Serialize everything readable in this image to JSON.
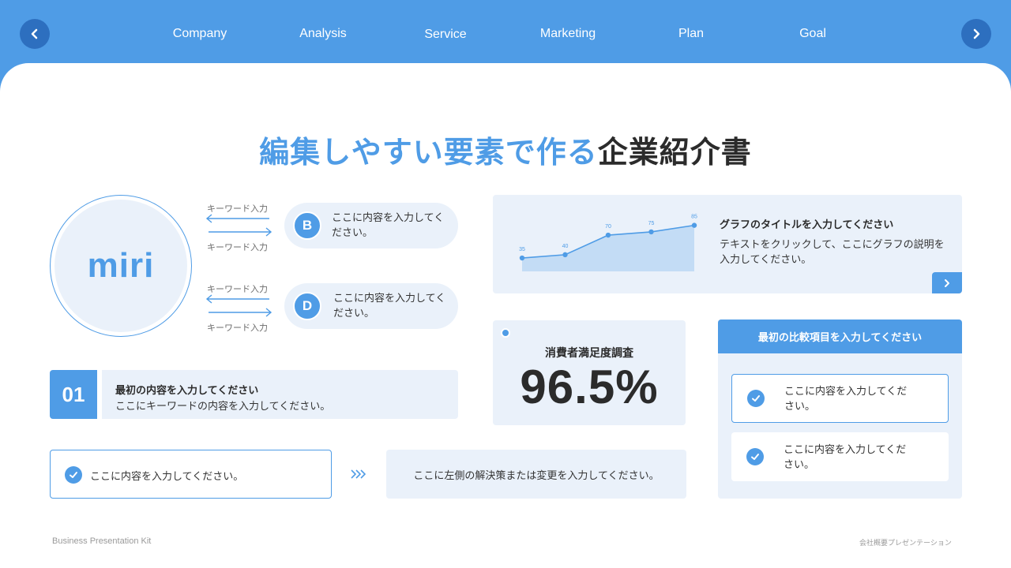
{
  "nav": {
    "items": [
      "Company",
      "Analysis",
      "Service",
      "Marketing",
      "Plan",
      "Goal"
    ],
    "prev_icon": "chevron-left-icon",
    "next_icon": "chevron-right-icon"
  },
  "title": {
    "highlight": "編集しやすい要素で作る",
    "rest": "企業紹介書"
  },
  "logo": {
    "text": "miri"
  },
  "keywords": {
    "label": "キーワード入力"
  },
  "pills": [
    {
      "badge": "B",
      "text": "ここに内容を入力してください。"
    },
    {
      "badge": "D",
      "text": "ここに内容を入力してください。"
    }
  ],
  "step": {
    "number": "01",
    "title": "最初の内容を入力してください",
    "desc": "ここにキーワードの内容を入力してください。"
  },
  "check_box": {
    "text": "ここに内容を入力してください。"
  },
  "solution": {
    "text": "ここに左側の解決策または変更を入力してください。"
  },
  "chart_card": {
    "title": "グラフのタイトルを入力してください",
    "desc": "テキストをクリックして、ここにグラフの説明を入力してください。"
  },
  "chart_data": {
    "type": "area",
    "x": [
      1,
      2,
      3,
      4,
      5
    ],
    "values": [
      35,
      40,
      70,
      75,
      85
    ],
    "title": "",
    "xlabel": "",
    "ylabel": "",
    "ylim": [
      0,
      100
    ],
    "grid": false,
    "color": "#4f9ce6"
  },
  "stat": {
    "label": "消費者満足度調査",
    "value": "96.5%"
  },
  "compare": {
    "header": "最初の比較項目を入力してください",
    "items": [
      {
        "text": "ここに内容を入力してください。",
        "active": true
      },
      {
        "text": "ここに内容を入力してください。",
        "active": false
      }
    ]
  },
  "footer": {
    "left": "Business Presentation Kit",
    "right": "会社概要プレゼンテーション"
  },
  "colors": {
    "accent": "#4f9ce6",
    "panel": "#eaf1fa",
    "dark": "#2b2b2b"
  }
}
